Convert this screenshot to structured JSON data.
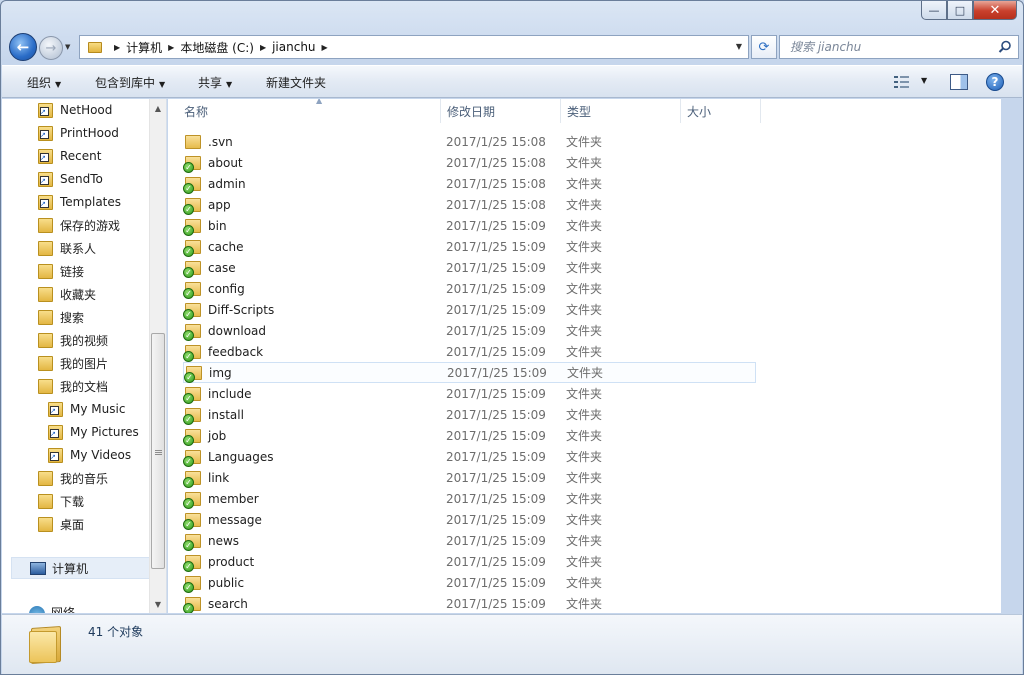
{
  "window": {
    "min_glyph": "—",
    "max_glyph": "□",
    "close_glyph": "✕"
  },
  "nav": {
    "back_glyph": "←",
    "forward_glyph": "→",
    "breadcrumbs": [
      "计算机",
      "本地磁盘 (C:)",
      "jianchu"
    ],
    "search_placeholder": "搜索 jianchu"
  },
  "toolbar": {
    "organize": "组织",
    "include_in_library": "包含到库中",
    "share": "共享",
    "new_folder": "新建文件夹",
    "help_glyph": "?"
  },
  "sidebar": {
    "items": [
      {
        "label": "NetHood",
        "icon": "folder-shortcut-icon"
      },
      {
        "label": "PrintHood",
        "icon": "folder-shortcut-icon"
      },
      {
        "label": "Recent",
        "icon": "folder-shortcut-icon"
      },
      {
        "label": "SendTo",
        "icon": "folder-shortcut-icon"
      },
      {
        "label": "Templates",
        "icon": "folder-shortcut-icon"
      },
      {
        "label": "保存的游戏",
        "icon": "folder-icon"
      },
      {
        "label": "联系人",
        "icon": "folder-icon"
      },
      {
        "label": "链接",
        "icon": "folder-icon"
      },
      {
        "label": "收藏夹",
        "icon": "folder-icon"
      },
      {
        "label": "搜索",
        "icon": "folder-icon"
      },
      {
        "label": "我的视频",
        "icon": "folder-icon"
      },
      {
        "label": "我的图片",
        "icon": "folder-icon"
      },
      {
        "label": "我的文档",
        "icon": "folder-icon"
      },
      {
        "label": "My Music",
        "icon": "folder-shortcut-icon"
      },
      {
        "label": "My Pictures",
        "icon": "folder-shortcut-icon"
      },
      {
        "label": "My Videos",
        "icon": "folder-shortcut-icon"
      },
      {
        "label": "我的音乐",
        "icon": "folder-icon"
      },
      {
        "label": "下载",
        "icon": "folder-icon"
      },
      {
        "label": "桌面",
        "icon": "folder-icon"
      }
    ],
    "computer": "计算机",
    "network": "网络"
  },
  "columns": {
    "name": "名称",
    "modified": "修改日期",
    "type": "类型",
    "size": "大小"
  },
  "files": [
    {
      "name": ".svn",
      "date": "2017/1/25 15:08",
      "type": "文件夹",
      "versioned": false
    },
    {
      "name": "about",
      "date": "2017/1/25 15:08",
      "type": "文件夹",
      "versioned": true
    },
    {
      "name": "admin",
      "date": "2017/1/25 15:08",
      "type": "文件夹",
      "versioned": true
    },
    {
      "name": "app",
      "date": "2017/1/25 15:08",
      "type": "文件夹",
      "versioned": true
    },
    {
      "name": "bin",
      "date": "2017/1/25 15:09",
      "type": "文件夹",
      "versioned": true
    },
    {
      "name": "cache",
      "date": "2017/1/25 15:09",
      "type": "文件夹",
      "versioned": true
    },
    {
      "name": "case",
      "date": "2017/1/25 15:09",
      "type": "文件夹",
      "versioned": true
    },
    {
      "name": "config",
      "date": "2017/1/25 15:09",
      "type": "文件夹",
      "versioned": true
    },
    {
      "name": "Diff-Scripts",
      "date": "2017/1/25 15:09",
      "type": "文件夹",
      "versioned": true
    },
    {
      "name": "download",
      "date": "2017/1/25 15:09",
      "type": "文件夹",
      "versioned": true
    },
    {
      "name": "feedback",
      "date": "2017/1/25 15:09",
      "type": "文件夹",
      "versioned": true
    },
    {
      "name": "img",
      "date": "2017/1/25 15:09",
      "type": "文件夹",
      "versioned": true,
      "hover": true
    },
    {
      "name": "include",
      "date": "2017/1/25 15:09",
      "type": "文件夹",
      "versioned": true
    },
    {
      "name": "install",
      "date": "2017/1/25 15:09",
      "type": "文件夹",
      "versioned": true
    },
    {
      "name": "job",
      "date": "2017/1/25 15:09",
      "type": "文件夹",
      "versioned": true
    },
    {
      "name": "Languages",
      "date": "2017/1/25 15:09",
      "type": "文件夹",
      "versioned": true
    },
    {
      "name": "link",
      "date": "2017/1/25 15:09",
      "type": "文件夹",
      "versioned": true
    },
    {
      "name": "member",
      "date": "2017/1/25 15:09",
      "type": "文件夹",
      "versioned": true
    },
    {
      "name": "message",
      "date": "2017/1/25 15:09",
      "type": "文件夹",
      "versioned": true
    },
    {
      "name": "news",
      "date": "2017/1/25 15:09",
      "type": "文件夹",
      "versioned": true
    },
    {
      "name": "product",
      "date": "2017/1/25 15:09",
      "type": "文件夹",
      "versioned": true
    },
    {
      "name": "public",
      "date": "2017/1/25 15:09",
      "type": "文件夹",
      "versioned": true
    },
    {
      "name": "search",
      "date": "2017/1/25 15:09",
      "type": "文件夹",
      "versioned": true
    }
  ],
  "details": {
    "count": "41 个对象"
  },
  "colors": {
    "frame": "#c6d6ec",
    "selection_border": "#cfe1f5",
    "svn_ok": "#2f9b1b"
  }
}
